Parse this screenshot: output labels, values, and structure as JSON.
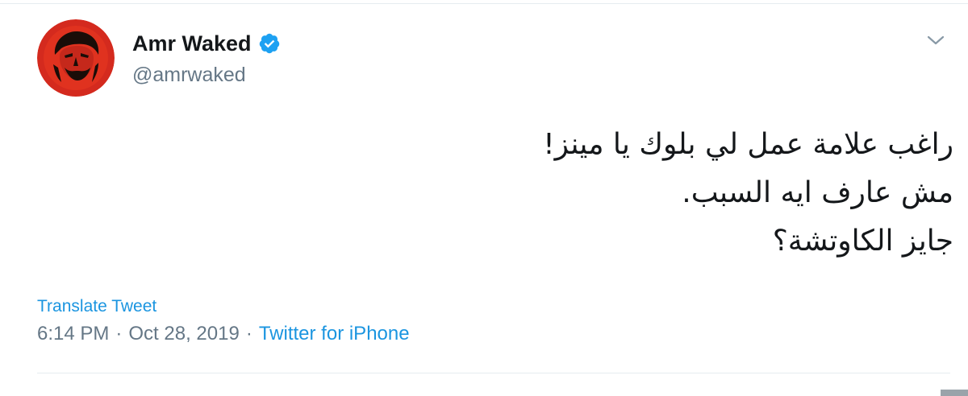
{
  "user": {
    "display_name": "Amr Waked",
    "handle": "@amrwaked",
    "verified": true,
    "avatar_icon": "avatar-portrait-red"
  },
  "tweet": {
    "lines": [
      "راغب علامة عمل لي بلوك يا مينز!",
      "مش عارف ايه السبب.",
      "جايز الكاوتشة؟"
    ],
    "translate_label": "Translate Tweet",
    "time": "6:14 PM",
    "separator": "·",
    "date": "Oct 28, 2019",
    "source": "Twitter for iPhone"
  },
  "icons": {
    "verified": "verified-badge-icon",
    "more": "chevron-down-icon"
  },
  "colors": {
    "link": "#1b95e0",
    "secondary_text": "#657786",
    "primary_text": "#14171a",
    "avatar_red": "#d42a1e"
  }
}
